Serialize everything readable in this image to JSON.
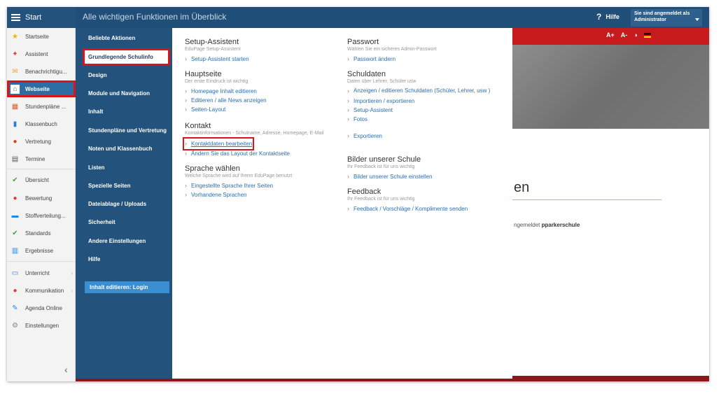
{
  "topbar": {
    "start_label": "Start",
    "title": "Alle wichtigen Funktionen im Überblick",
    "help_icon": "?",
    "help_label": "Hilfe",
    "user_line1": "Sie sind angemeldet als",
    "user_line2": "Administrator"
  },
  "sidebar": {
    "items": [
      {
        "label": "Startseite",
        "icon": "star-icon",
        "glyph": "★",
        "color": "#f4b400"
      },
      {
        "label": "Assistent",
        "icon": "wand-icon",
        "glyph": "✦",
        "color": "#e53935"
      },
      {
        "label": "Benachrichtigu...",
        "icon": "envelope-icon",
        "glyph": "✉",
        "color": "#f6a623"
      },
      {
        "label": "Webseite",
        "icon": "home-icon",
        "glyph": "⌂",
        "color": "#ffffff"
      },
      {
        "label": "Stundenpläne ...",
        "icon": "timetable-icon",
        "glyph": "▦",
        "color": "#e05a2b"
      },
      {
        "label": "Klassenbuch",
        "icon": "book-icon",
        "glyph": "▮",
        "color": "#2e7bd6"
      },
      {
        "label": "Vertretung",
        "icon": "substitute-icon",
        "glyph": "●",
        "color": "#d84315"
      },
      {
        "label": "Termine",
        "icon": "calendar-icon",
        "glyph": "▤",
        "color": "#555555"
      },
      {
        "label": "Übersicht",
        "icon": "check-circle-icon",
        "glyph": "✔",
        "color": "#43a047"
      },
      {
        "label": "Bewertung",
        "icon": "grade-icon",
        "glyph": "●",
        "color": "#e53935"
      },
      {
        "label": "Stoffverteilung...",
        "icon": "distribution-icon",
        "glyph": "▬",
        "color": "#1e88e5"
      },
      {
        "label": "Standards",
        "icon": "shield-icon",
        "glyph": "✔",
        "color": "#43a047"
      },
      {
        "label": "Ergebnisse",
        "icon": "bar-chart-icon",
        "glyph": "▥",
        "color": "#1e88e5"
      },
      {
        "label": "Unterricht",
        "icon": "lesson-icon",
        "glyph": "▭",
        "color": "#2e7bd6"
      },
      {
        "label": "Kommunikation",
        "icon": "chat-icon",
        "glyph": "●",
        "color": "#e53935"
      },
      {
        "label": "Agenda Online",
        "icon": "pen-icon",
        "glyph": "✎",
        "color": "#1e88e5"
      },
      {
        "label": "Einstellungen",
        "icon": "gear-icon",
        "glyph": "⚙",
        "color": "#888888"
      }
    ],
    "collapse_glyph": "‹"
  },
  "menu": {
    "items": [
      "Beliebte Aktionen",
      "Grundlegende Schulinfo",
      "Design",
      "Module und Navigation",
      "Inhalt",
      "Stundenpläne und Vertretung",
      "Noten und Klassenbuch",
      "Listen",
      "Spezielle Seiten",
      "Dateiablage / Uploads",
      "Sicherheit",
      "Andere Einstellungen",
      "Hilfe"
    ],
    "login_button": "Inhalt editieren: Login"
  },
  "content": {
    "setup": {
      "title": "Setup-Assistent",
      "desc": "EduPage Setup-Assistent",
      "links": [
        "Setup-Assistent starten"
      ]
    },
    "hauptseite": {
      "title": "Hauptseite",
      "desc": "Der erste Eindruck ist wichtig",
      "links": [
        "Homepage Inhalt editieren",
        "Editieren / alle News anzeigen",
        "Seiten-Layout"
      ]
    },
    "kontakt": {
      "title": "Kontakt",
      "desc": "Kontaktinformationen - Schulname, Adresse, Homepage, E-Mail",
      "links": [
        "Kontaktdaten bearbeiten",
        "Ändern Sie das Layout der Kontaktseite"
      ]
    },
    "sprache": {
      "title": "Sprache wählen",
      "desc": "Welche Sprache wird auf Ihrem EduPage benutzt",
      "links": [
        "Eingestellte Sprache Ihrer Seiten",
        "Vorhandene Sprachen"
      ]
    },
    "passwort": {
      "title": "Passwort",
      "desc": "Wählen Sie ein sicheres Admin-Passwort",
      "links": [
        "Passwort ändern"
      ]
    },
    "schuldaten": {
      "title": "Schuldaten",
      "desc": "Daten über Lehrer, Schüler usw",
      "links": [
        "Anzeigen / editieren Schuldaten (Schüler, Lehrer, usw )",
        "Importieren / exportieren",
        "Setup-Assistent",
        "Fotos",
        "Exportieren"
      ]
    },
    "bilder": {
      "title": "Bilder unserer Schule",
      "desc": "Ihr Feedback ist für uns wichtig",
      "links": [
        "Bilder unserer Schule einstellen"
      ]
    },
    "feedback": {
      "title": "Feedback",
      "desc": "Ihr Feedback ist für uns wichtig",
      "links": [
        "Feedback / Vorschläge / Komplimente senden"
      ]
    }
  },
  "preview": {
    "font_bigger": "A+",
    "font_smaller": "A-",
    "contrast_icon": "◑",
    "heading_fragment": "en",
    "text_prefix": "ngemeldet",
    "text_user": "pparkerschule"
  },
  "colors": {
    "topbar": "#1f4f78",
    "menu_panel": "#23527c",
    "highlight_red": "#d9151c",
    "link_blue": "#2a6fb1",
    "preview_red": "#c61a1d"
  }
}
